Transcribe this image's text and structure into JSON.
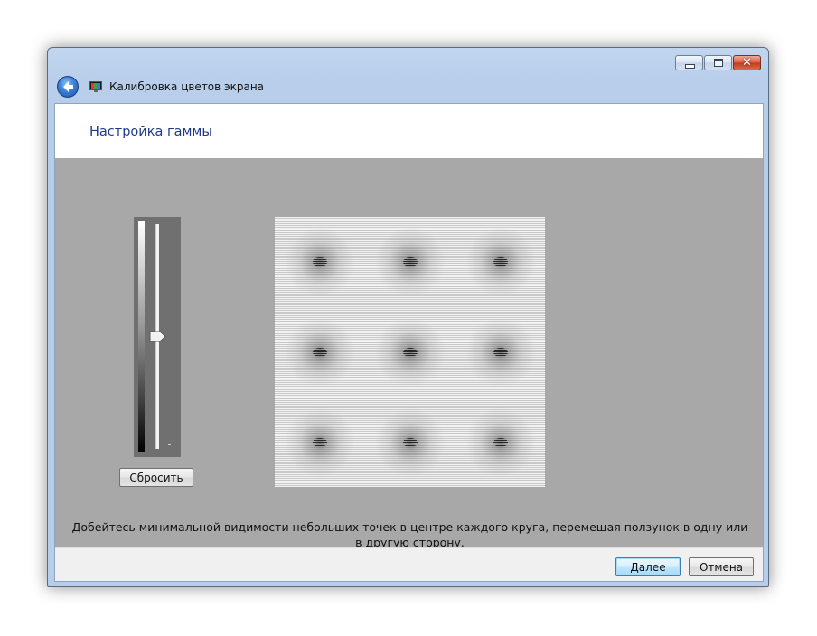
{
  "window": {
    "title": "Калибровка цветов экрана",
    "caption_close_glyph": "✕"
  },
  "header": {
    "page_title": "Настройка гаммы"
  },
  "slider": {
    "reset_label": "Сбросить",
    "value_fraction": 0.5
  },
  "pattern": {
    "rows": 3,
    "cols": 3
  },
  "instruction": "Добейтесь минимальной видимости небольших точек в центре каждого круга, перемещая ползунок в одну или в другую сторону.",
  "footer": {
    "next_label": "Далее",
    "cancel_label": "Отмена"
  },
  "colors": {
    "title_blue": "#1e3a8a",
    "client_gray": "#a8a8a8",
    "close_red": "#c23a1e"
  },
  "icons": {
    "back": "back-arrow-icon",
    "app": "monitor-color-icon",
    "thumb": "slider-thumb-icon"
  }
}
